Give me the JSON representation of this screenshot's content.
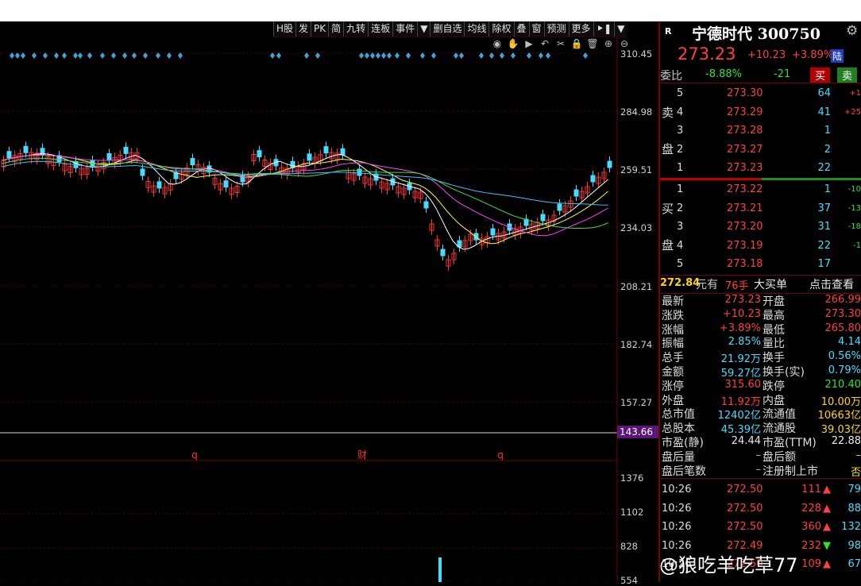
{
  "toolbar": {
    "buttons": [
      "H股",
      "发",
      "PK",
      "简",
      "九转",
      "连板",
      "事件",
      "▼",
      "删自选",
      "均线",
      "除权",
      "叠",
      "窗",
      "预测",
      "更多",
      "⯈❚",
      "▼"
    ]
  },
  "tool_icons": [
    "eye-icon",
    "hand-icon",
    "play-icon",
    "undo-icon",
    "scissors-icon",
    "lock-icon",
    "trash-icon",
    "zoom-in-icon",
    "zoom-out-icon"
  ],
  "price_axis": [
    "310.45",
    "284.98",
    "259.51",
    "234.03",
    "208.21",
    "182.74",
    "157.27"
  ],
  "current_price_marker": "143.66",
  "event_markers": [
    {
      "label": "q",
      "color": "#ff3030"
    },
    {
      "label": "财",
      "color": "#ff3030"
    },
    {
      "label": "q",
      "color": "#ff3030"
    }
  ],
  "volume_axis": [
    "1376",
    "1102",
    "828",
    "554"
  ],
  "stock": {
    "name": "宁德时代 300750",
    "r_label": "R",
    "price": "273.23",
    "change": "+10.23",
    "change_pct": "+3.89%",
    "market_tag": "陆",
    "weibi_label": "委比",
    "weibi_pct": "-8.88%",
    "weibi_val": "-21",
    "buy_btn": "买",
    "sell_btn": "卖"
  },
  "sell_label": [
    "卖",
    "盘"
  ],
  "buy_label": [
    "买",
    "盘"
  ],
  "asks": [
    {
      "level": "5",
      "price": "273.30",
      "vol": "64",
      "chg": "+1"
    },
    {
      "level": "4",
      "price": "273.29",
      "vol": "41",
      "chg": "+25"
    },
    {
      "level": "3",
      "price": "273.28",
      "vol": "1",
      "chg": ""
    },
    {
      "level": "2",
      "price": "273.27",
      "vol": "2",
      "chg": ""
    },
    {
      "level": "1",
      "price": "273.23",
      "vol": "22",
      "chg": ""
    }
  ],
  "bids": [
    {
      "level": "1",
      "price": "273.22",
      "vol": "1",
      "chg": "-10"
    },
    {
      "level": "2",
      "price": "273.21",
      "vol": "37",
      "chg": "-13"
    },
    {
      "level": "3",
      "price": "273.20",
      "vol": "31",
      "chg": "-18"
    },
    {
      "level": "4",
      "price": "273.19",
      "vol": "22",
      "chg": "-1"
    },
    {
      "level": "5",
      "price": "273.18",
      "vol": "17",
      "chg": ""
    }
  ],
  "big_order": {
    "price": "272.84",
    "unit": "元有",
    "vol": "76手",
    "label": "大买单",
    "action": "点击查看"
  },
  "stats": [
    [
      "最新",
      "273.23",
      "开盘",
      "266.99"
    ],
    [
      "涨跌",
      "+10.23",
      "最高",
      "273.30"
    ],
    [
      "涨幅",
      "+3.89%",
      "最低",
      "265.80"
    ],
    [
      "振幅",
      "2.85%",
      "量比",
      "4.14"
    ],
    [
      "总手",
      "21.92万",
      "换手",
      "0.56%"
    ],
    [
      "金额",
      "59.27亿",
      "换手(实)",
      "0.79%"
    ],
    [
      "涨停",
      "315.60",
      "跌停",
      "210.40"
    ],
    [
      "外盘",
      "11.92万",
      "内盘",
      "10.00万"
    ],
    [
      "总市值",
      "12402亿",
      "流通值",
      "10663亿"
    ],
    [
      "总股本",
      "45.39亿",
      "流通股",
      "39.03亿"
    ],
    [
      "市盈(静)",
      "24.44",
      "市盈(TTM)",
      "22.88"
    ],
    [
      "盘后量",
      "–",
      "盘后额",
      "–"
    ],
    [
      "盘后笔数",
      "–",
      "注册制上市",
      "否"
    ]
  ],
  "ticks": [
    {
      "time": "10:26",
      "price": "272.50",
      "vol": "111",
      "dir": "up",
      "n": "79"
    },
    {
      "time": "10:26",
      "price": "272.50",
      "vol": "228",
      "dir": "up",
      "n": "88"
    },
    {
      "time": "10:26",
      "price": "272.50",
      "vol": "360",
      "dir": "up",
      "n": "132"
    },
    {
      "time": "10:26",
      "price": "272.49",
      "vol": "232",
      "dir": "down",
      "n": "98"
    },
    {
      "time": "10:26",
      "price": "272.50",
      "vol": "109",
      "dir": "up",
      "n": "67"
    }
  ],
  "watermark": "@狼吃羊吃草77",
  "colors": {
    "up": "#ff3030",
    "down": "#44ddff",
    "accent": "#7a0000",
    "purple": "#5a1778"
  }
}
